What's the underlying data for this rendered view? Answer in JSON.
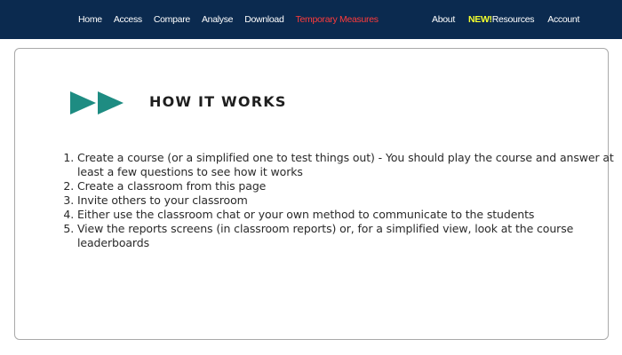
{
  "nav": {
    "left": {
      "home": "Home",
      "access": "Access",
      "compare": "Compare",
      "analyse": "Analyse",
      "download": "Download",
      "temporary_measures": "Temporary Measures"
    },
    "right": {
      "about": "About",
      "new_badge": "NEW!",
      "resources": "Resources",
      "account": "Account"
    }
  },
  "how_it_works": {
    "title": "HOW IT WORKS",
    "icon": "fast-forward-icon",
    "steps": [
      "Create a course (or a simplified one to test things out) - You should play the course and answer at least a few questions to see how it works",
      "Create a classroom from this page",
      "Invite others to your classroom",
      "Either use the classroom chat or your own method to communicate to the students",
      "View the reports screens (in classroom reports) or, for a simplified view, look at the course leaderboards"
    ]
  },
  "colors": {
    "nav_background": "#0b2a4f",
    "temporary_measures": "#ff3b3b",
    "new_badge": "#f3ff2e",
    "icon_teal": "#1e8c82"
  }
}
